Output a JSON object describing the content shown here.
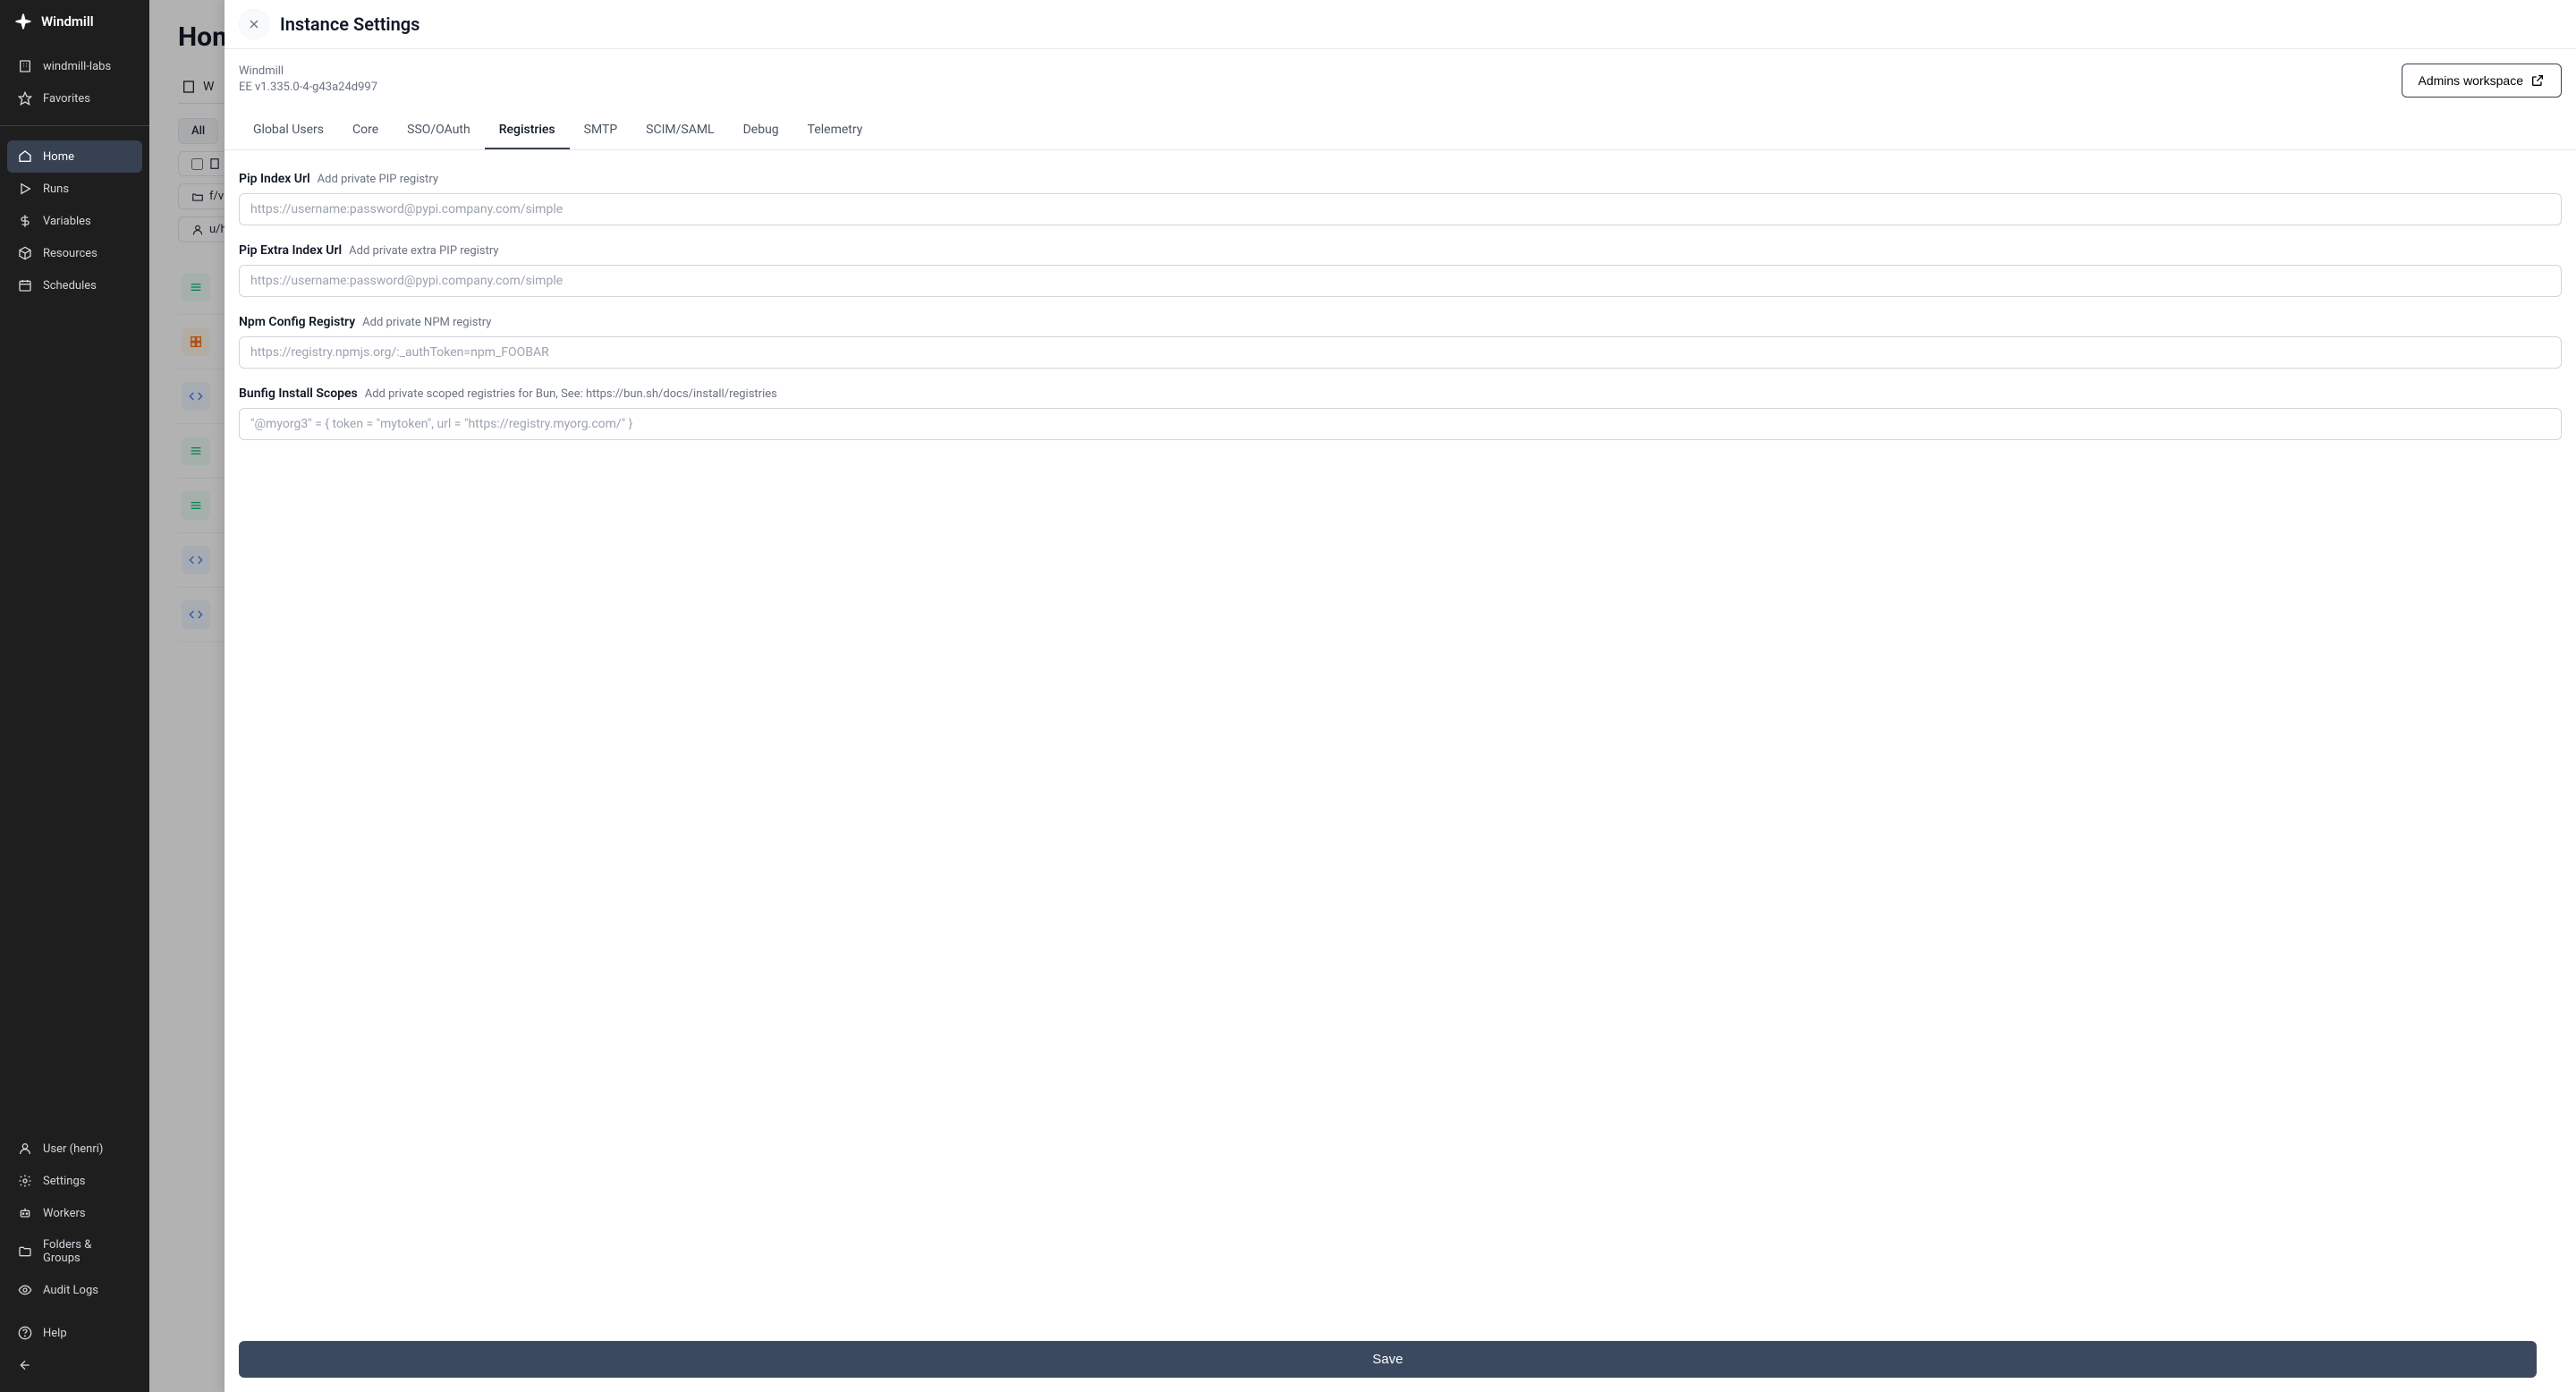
{
  "app": {
    "name": "Windmill"
  },
  "sidebar": {
    "workspace": "windmill-labs",
    "favorites": "Favorites",
    "nav": {
      "home": "Home",
      "runs": "Runs",
      "variables": "Variables",
      "resources": "Resources",
      "schedules": "Schedules"
    },
    "bottom": {
      "user": "User (henri)",
      "settings": "Settings",
      "workers": "Workers",
      "folders": "Folders & Groups",
      "audit": "Audit Logs",
      "help": "Help"
    }
  },
  "main": {
    "title": "Home",
    "filter_all": "All",
    "folder_prefix": "f/v",
    "user_prefix": "u/h"
  },
  "modal": {
    "title": "Instance Settings",
    "product": "Windmill",
    "version": "EE v1.335.0-4-g43a24d997",
    "admins_btn": "Admins workspace",
    "tabs": {
      "global_users": "Global Users",
      "core": "Core",
      "sso": "SSO/OAuth",
      "registries": "Registries",
      "smtp": "SMTP",
      "scim": "SCIM/SAML",
      "debug": "Debug",
      "telemetry": "Telemetry"
    },
    "fields": {
      "pip_index": {
        "label": "Pip Index Url",
        "sub": "Add private PIP registry",
        "placeholder": "https://username:password@pypi.company.com/simple"
      },
      "pip_extra": {
        "label": "Pip Extra Index Url",
        "sub": "Add private extra PIP registry",
        "placeholder": "https://username:password@pypi.company.com/simple"
      },
      "npm": {
        "label": "Npm Config Registry",
        "sub": "Add private NPM registry",
        "placeholder": "https://registry.npmjs.org/:_authToken=npm_FOOBAR"
      },
      "bunfig": {
        "label": "Bunfig Install Scopes",
        "sub": "Add private scoped registries for Bun, See: https://bun.sh/docs/install/registries",
        "placeholder": "\"@myorg3\" = { token = \"mytoken\", url = \"https://registry.myorg.com/\" }"
      }
    },
    "save": "Save"
  }
}
